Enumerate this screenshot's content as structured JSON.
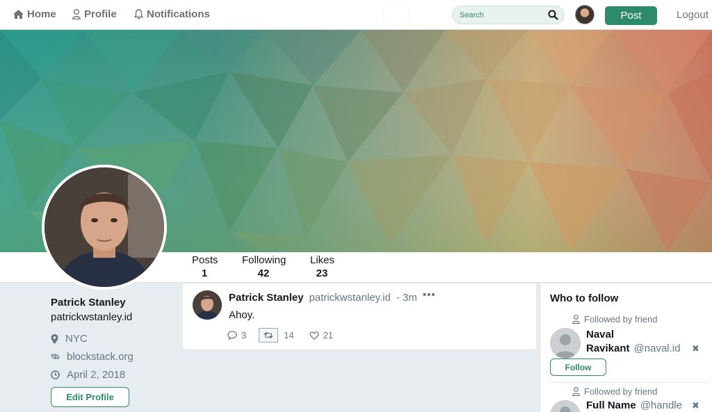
{
  "nav": {
    "home_label": "Home",
    "profile_label": "Profile",
    "notifications_label": "Notifications",
    "search_placeholder": "Search",
    "post_label": "Post",
    "logout_label": "Logout"
  },
  "stats": [
    {
      "label": "Posts",
      "value": "1"
    },
    {
      "label": "Following",
      "value": "42"
    },
    {
      "label": "Likes",
      "value": "23"
    }
  ],
  "profile": {
    "name": "Patrick Stanley",
    "handle": "patrickwstanley.id",
    "location": "NYC",
    "website": "blockstack.org",
    "joined": "April 2, 2018",
    "edit_label": "Edit Profile"
  },
  "post": {
    "author": "Patrick Stanley",
    "handle": "patrickwstanley.id",
    "time": "- 3m",
    "more": "•••",
    "text": "Ahoy.",
    "replies": "3",
    "retweets": "14",
    "likes": "21"
  },
  "who_to_follow": {
    "title": "Who to follow",
    "suggestions": [
      {
        "followed_by": "Followed by friend",
        "name_line1": "Naval",
        "name_line2": "Ravikant",
        "handle": "@naval.id",
        "follow_label": "Follow"
      },
      {
        "followed_by": "Followed by friend",
        "name_line1": "Full Name",
        "handle": "@handle"
      }
    ]
  },
  "colors": {
    "accent": "#2e8b6a",
    "muted": "#657786"
  }
}
